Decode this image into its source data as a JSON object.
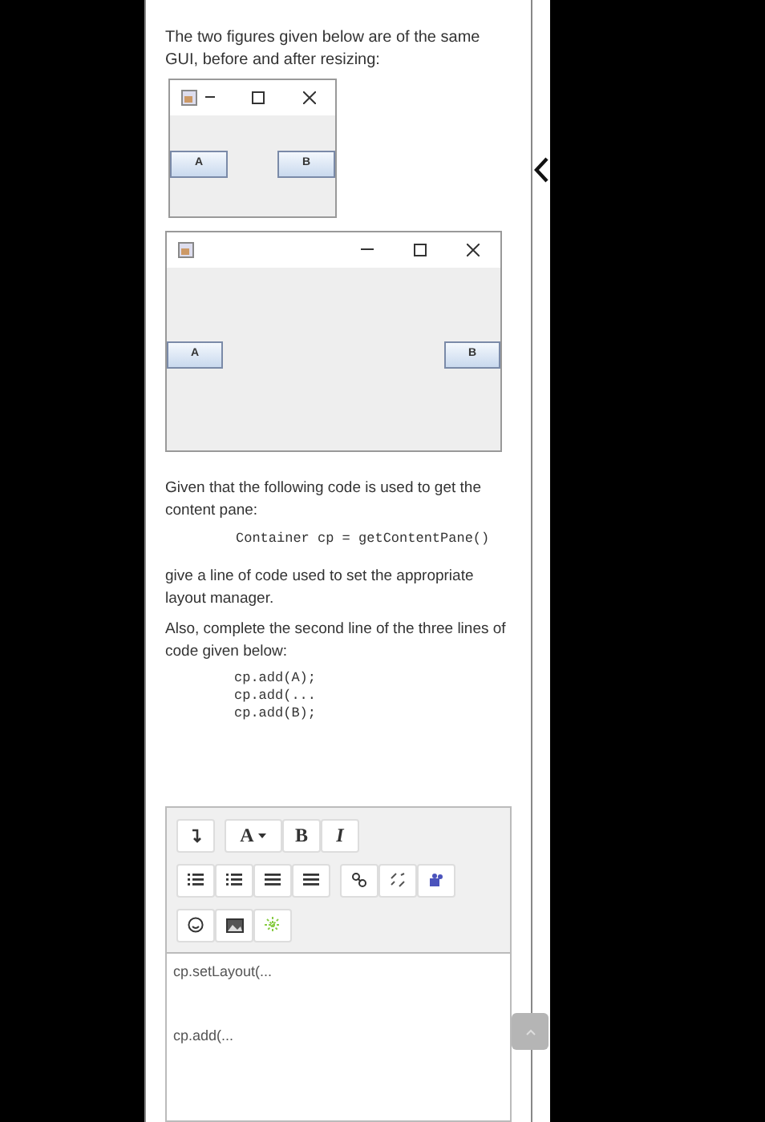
{
  "question": {
    "intro": "The two figures given below are of the same GUI, before and after resizing:",
    "figures": [
      {
        "buttons": [
          "A",
          "B"
        ]
      },
      {
        "buttons": [
          "A",
          "B"
        ]
      }
    ],
    "paragraph_2": "Given that the following code is used to get the content pane:",
    "code_1": "Container cp = getContentPane()",
    "paragraph_3": "give a line of code used to set the appropriate layout manager.",
    "paragraph_4": "Also, complete the second line of the three lines of code given below:",
    "code_2": [
      "cp.add(A);",
      "cp.add(...",
      "cp.add(B);"
    ]
  },
  "editor": {
    "toolbar": {
      "font_button": "A",
      "bold_button": "B",
      "italic_button": "I"
    },
    "lines": [
      "cp.setLayout(...",
      "cp.add(..."
    ]
  }
}
